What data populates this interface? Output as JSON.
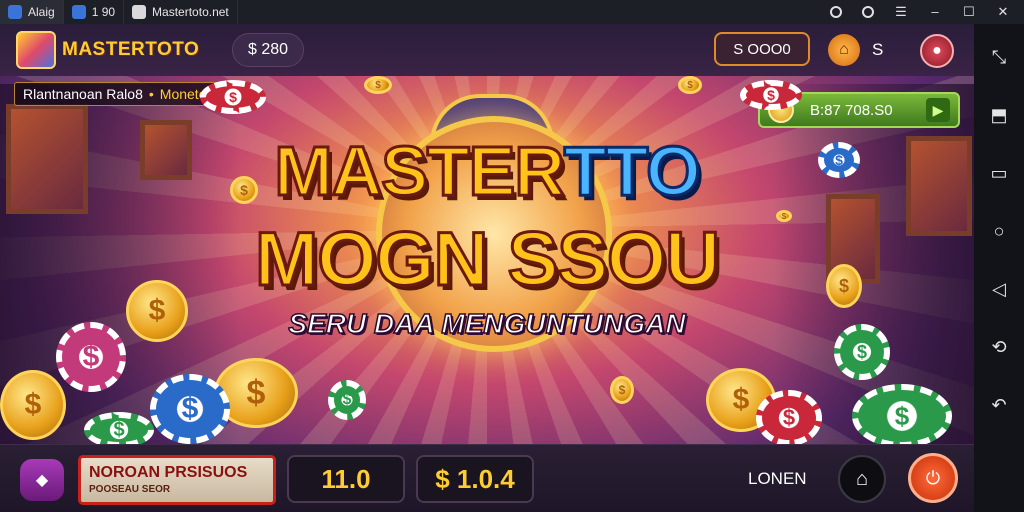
{
  "window": {
    "tabs": [
      {
        "label": "Alaig",
        "active": true
      },
      {
        "label": "1 90"
      },
      {
        "label": "Mastertoto.net"
      }
    ],
    "controls": [
      "target-icon",
      "record-icon",
      "menu-icon",
      "minimize-icon",
      "maximize-icon",
      "close-icon"
    ]
  },
  "sidebar": {
    "items": [
      "expand-icon",
      "screen-icon",
      "window-icon",
      "home-icon",
      "back-icon",
      "rotate-icon",
      "undo-icon"
    ]
  },
  "header": {
    "logo_text": "MASTERTOTO",
    "balance": "$ 280",
    "coins": "S OOO0",
    "shop_label": "S"
  },
  "ticker": {
    "text": "Rlantnanoan Ralo8",
    "highlight": "Monetogozn"
  },
  "jackpot": {
    "amount": "B:87 708.S0"
  },
  "hero": {
    "title_part1": "MASTER",
    "title_part2": "TTO",
    "title_line2": "MOGN SSOU",
    "subtitle": "SERU DAA MENGUNTUNGAN"
  },
  "bottom": {
    "promo_line1": "NOROAN PRSISUOS",
    "promo_line2": "POOSEAU SEOR",
    "bet": "11.0",
    "win": "$ 1.0.4",
    "label": "LONEN"
  },
  "colors": {
    "gold": "#ffc21a",
    "blue": "#4ab4ff",
    "green": "#7ab83a",
    "promo_border": "#c8201a"
  }
}
